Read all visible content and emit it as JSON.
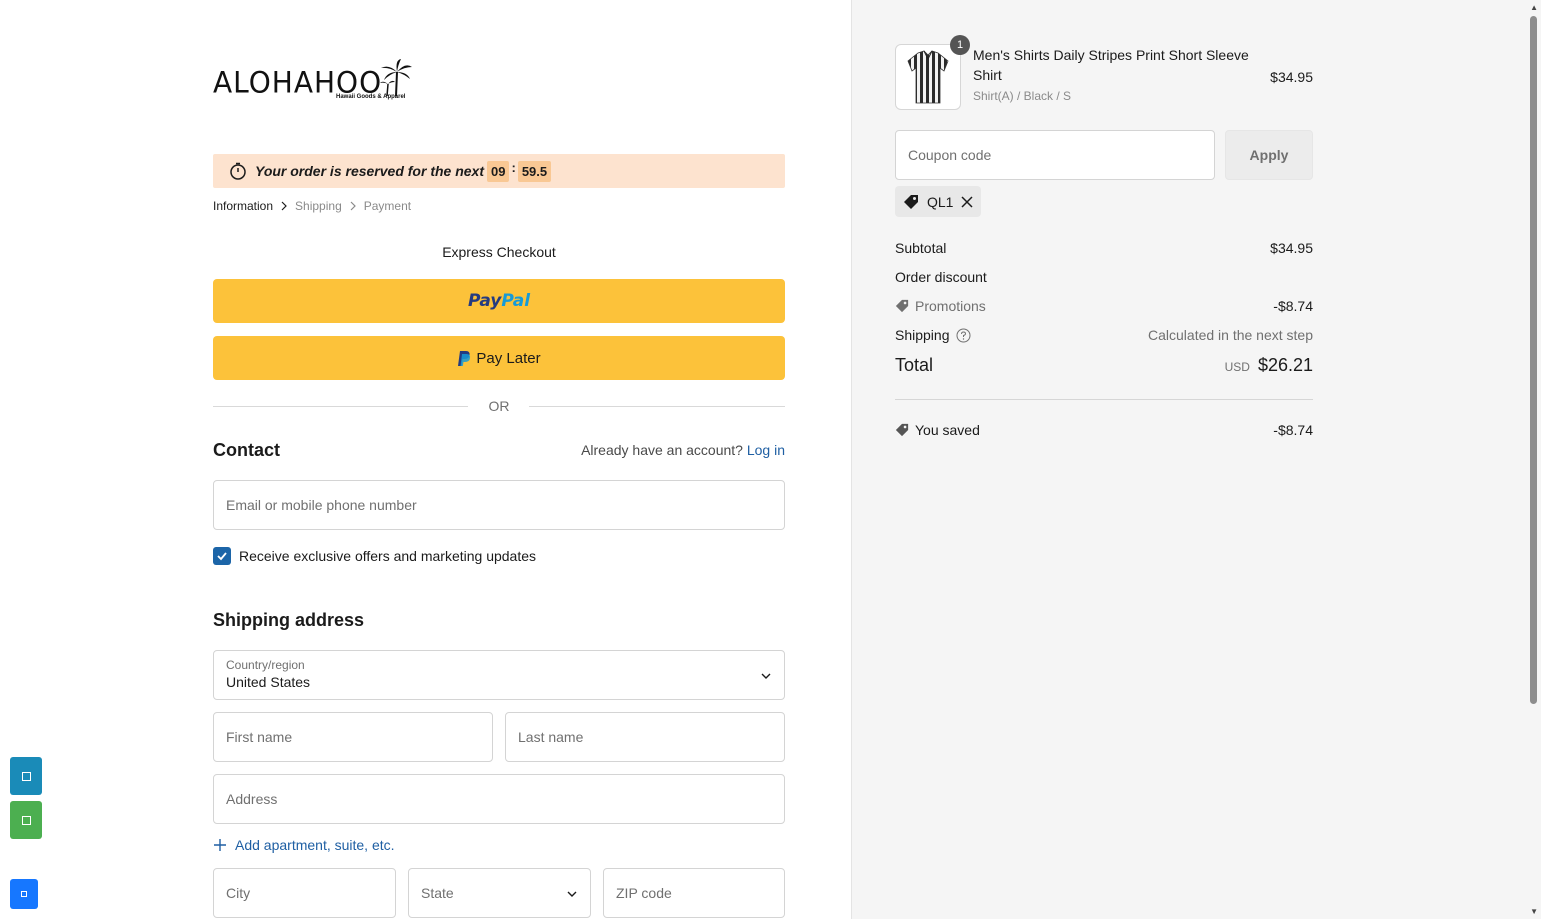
{
  "brand": {
    "logo_text": "ALOHAHOO",
    "logo_tagline": "Hawaii Goods & Apparel"
  },
  "reservation": {
    "text": "Your order is reserved for the next",
    "minutes": "09",
    "separator": ":",
    "seconds": "59.5"
  },
  "breadcrumb": {
    "items": [
      "Information",
      "Shipping",
      "Payment"
    ]
  },
  "express": {
    "title": "Express Checkout",
    "paypal_part1": "Pay",
    "paypal_part2": "Pal",
    "paylater_label": "Pay Later",
    "or_text": "OR"
  },
  "contact": {
    "title": "Contact",
    "account_prompt": "Already have an account?",
    "login_link": "Log in",
    "email_placeholder": "Email or mobile phone number",
    "marketing_label": "Receive exclusive offers and marketing updates",
    "marketing_checked": true
  },
  "shipping": {
    "title": "Shipping address",
    "country_label": "Country/region",
    "country_value": "United States",
    "first_name_placeholder": "First name",
    "last_name_placeholder": "Last name",
    "address_placeholder": "Address",
    "add_apartment": "Add apartment, suite, etc.",
    "city_placeholder": "City",
    "state_placeholder": "State",
    "zip_placeholder": "ZIP code"
  },
  "cart": {
    "item": {
      "quantity": "1",
      "name": "Men's Shirts Daily Stripes Print Short Sleeve Shirt",
      "variant": "Shirt(A) / Black / S",
      "price": "$34.95"
    },
    "coupon_placeholder": "Coupon code",
    "apply_label": "Apply",
    "applied_code": "QL1"
  },
  "summary": {
    "subtotal_label": "Subtotal",
    "subtotal_value": "$34.95",
    "discount_label": "Order discount",
    "promotions_label": "Promotions",
    "promotions_value": "-$8.74",
    "shipping_label": "Shipping",
    "shipping_value": "Calculated in the next step",
    "total_label": "Total",
    "currency": "USD",
    "total_value": "$26.21",
    "saved_label": "You saved",
    "saved_value": "-$8.74"
  },
  "colors": {
    "accent_blue": "#1c65a8",
    "paypal_yellow": "#fcc23a",
    "reserve_bg": "#fde3cf"
  }
}
